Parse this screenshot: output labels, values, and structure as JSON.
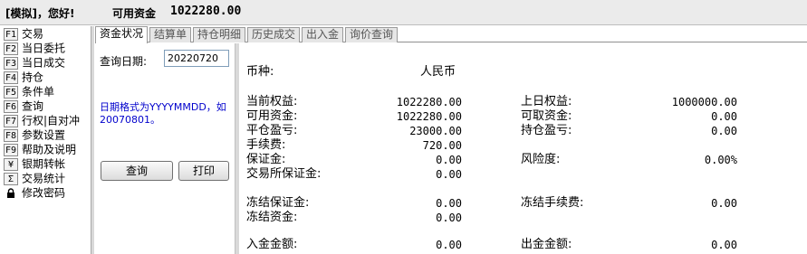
{
  "header": {
    "greeting": "[模拟]，您好!",
    "available_fund_label": "可用资金",
    "available_fund_value": "1022280.00"
  },
  "sidebar": {
    "items": [
      {
        "key": "F1",
        "label": "交易"
      },
      {
        "key": "F2",
        "label": "当日委托"
      },
      {
        "key": "F3",
        "label": "当日成交"
      },
      {
        "key": "F4",
        "label": "持仓"
      },
      {
        "key": "F5",
        "label": "条件单"
      },
      {
        "key": "F6",
        "label": "查询"
      },
      {
        "key": "F7",
        "label": "行权|自对冲"
      },
      {
        "key": "F8",
        "label": "参数设置"
      },
      {
        "key": "F9",
        "label": "帮助及说明"
      },
      {
        "key": "¥",
        "label": "银期转帐"
      },
      {
        "key": "Σ",
        "label": "交易统计"
      },
      {
        "key": "🔒",
        "label": "修改密码"
      }
    ]
  },
  "tabs": [
    {
      "label": "资金状况",
      "active": true
    },
    {
      "label": "结算单",
      "active": false
    },
    {
      "label": "持仓明细",
      "active": false
    },
    {
      "label": "历史成交",
      "active": false
    },
    {
      "label": "出入金",
      "active": false
    },
    {
      "label": "询价查询",
      "active": false
    }
  ],
  "query": {
    "date_label": "查询日期:",
    "date_value": "20220720",
    "format_note": "日期格式为YYYYMMDD，如20070801。",
    "query_button": "查询",
    "print_button": "打印"
  },
  "fund": {
    "currency_label": "币种:",
    "currency_value": "人民币",
    "left": [
      {
        "label": "当前权益:",
        "value": "1022280.00"
      },
      {
        "label": "可用资金:",
        "value": "1022280.00"
      },
      {
        "label": "平仓盈亏:",
        "value": "23000.00"
      },
      {
        "label": "手续费:",
        "value": "720.00"
      },
      {
        "label": "保证金:",
        "value": "0.00"
      },
      {
        "label": "交易所保证金:",
        "value": "0.00"
      },
      {
        "label": "冻结保证金:",
        "value": "0.00"
      },
      {
        "label": "冻结资金:",
        "value": "0.00"
      },
      {
        "label": "入金金额:",
        "value": "0.00"
      }
    ],
    "right": [
      {
        "label": "上日权益:",
        "value": "1000000.00"
      },
      {
        "label": "可取资金:",
        "value": "0.00"
      },
      {
        "label": "持仓盈亏:",
        "value": "0.00"
      },
      {
        "label": "风险度:",
        "value": "0.00%"
      },
      {
        "label": "冻结手续费:",
        "value": "0.00"
      },
      {
        "label": "出金金额:",
        "value": "0.00"
      }
    ]
  }
}
